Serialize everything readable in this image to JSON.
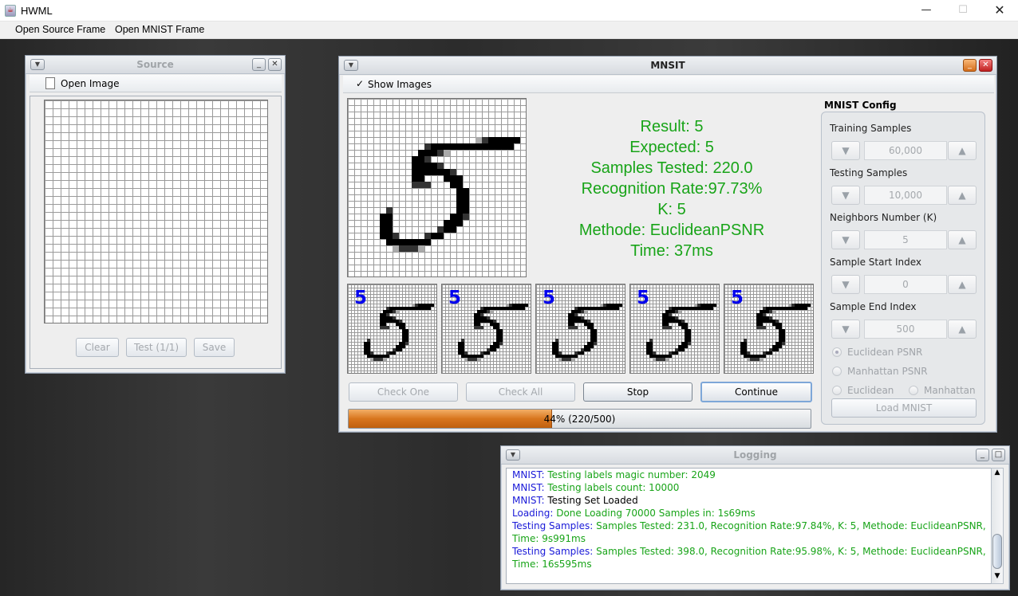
{
  "app": {
    "title": "HWML"
  },
  "menu": [
    "Open Source Frame",
    "Open MNIST Frame"
  ],
  "source": {
    "title": "Source",
    "open_label": "Open Image",
    "buttons": {
      "clear": "Clear",
      "test": "Test (1/1)",
      "save": "Save"
    }
  },
  "mnist": {
    "title": "MNSIT",
    "show_images": "Show Images",
    "result": {
      "result": "Result: 5",
      "expected": "Expected: 5",
      "tested": "Samples Tested: 220.0",
      "rate": "Recognition Rate:97.73%",
      "k": "K: 5",
      "method": "Methode: EuclideanPSNR",
      "time": "Time: 37ms"
    },
    "neighbors": [
      "5",
      "5",
      "5",
      "5",
      "5"
    ],
    "buttons": {
      "check_one": "Check One",
      "check_all": "Check All",
      "stop": "Stop",
      "continue": "Continue"
    },
    "progress": {
      "value": 0.44,
      "label": "44% (220/500)"
    },
    "config": {
      "title": "MNIST Config",
      "fields": [
        {
          "label": "Training Samples",
          "value": "60,000"
        },
        {
          "label": "Testing Samples",
          "value": "10,000"
        },
        {
          "label": "Neighbors Number (K)",
          "value": "5"
        },
        {
          "label": "Sample Start Index",
          "value": "0"
        },
        {
          "label": "Sample End Index",
          "value": "500"
        }
      ],
      "radios": [
        "Euclidean PSNR",
        "Manhattan PSNR",
        "Euclidean",
        "Manhattan"
      ],
      "load": "Load MNIST"
    }
  },
  "logging": {
    "title": "Logging",
    "lines": [
      {
        "src": "MNIST:",
        "msg": "Testing labels magic number: 2049"
      },
      {
        "src": "MNIST:",
        "msg": "Testing labels count: 10000"
      },
      {
        "src": "MNIST:",
        "msg": "Testing Set Loaded"
      },
      {
        "src": "Loading:",
        "msg": "Done Loading 70000 Samples in: 1s69ms"
      },
      {
        "src": "Testing Samples:",
        "msg": "Samples Tested: 231.0, Recognition Rate:97.84%, K: 5, Methode: EuclideanPSNR, Time: 9s991ms"
      },
      {
        "src": "Testing Samples:",
        "msg": "Samples Tested: 398.0, Recognition Rate:95.98%, K: 5, Methode: EuclideanPSNR, Time: 16s595ms"
      }
    ]
  },
  "colors": {
    "accent_green": "#18a418",
    "log_blue": "#1a1ad8",
    "progress_orange": "#d8761e",
    "digit_blue": "#0000ee"
  }
}
